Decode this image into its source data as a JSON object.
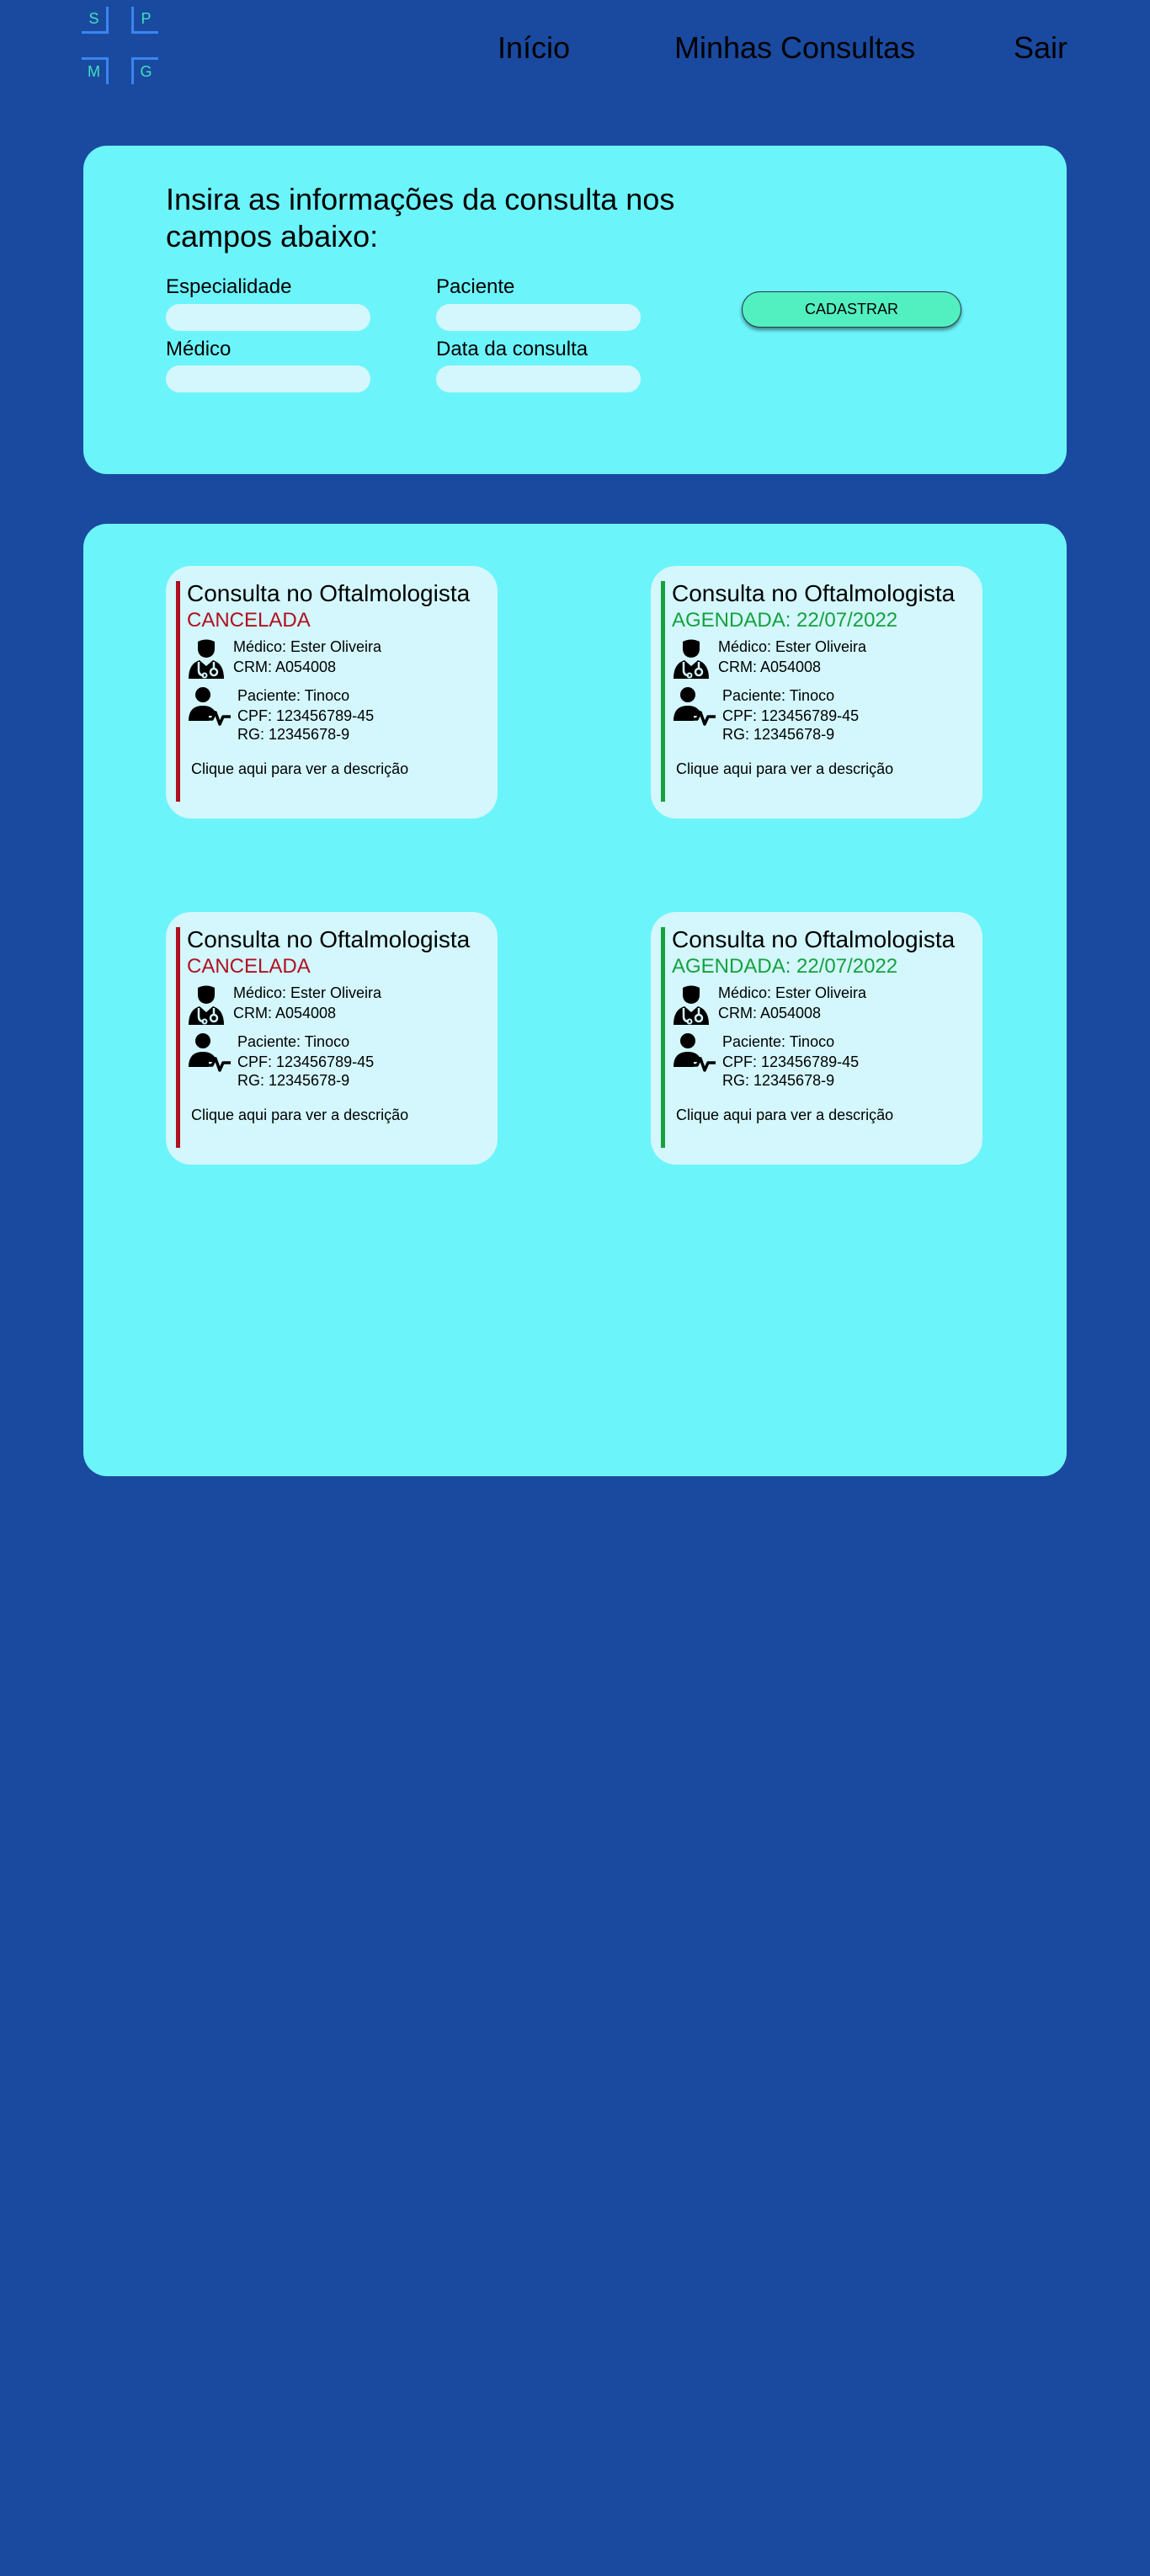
{
  "logo": {
    "letters": [
      "S",
      "P",
      "M",
      "G"
    ]
  },
  "nav": {
    "inicio": "Início",
    "consultas": "Minhas Consultas",
    "sair": "Sair"
  },
  "form": {
    "title": "Insira as informações da consulta nos campos abaixo:",
    "especialidade_label": "Especialidade",
    "paciente_label": "Paciente",
    "medico_label": "Médico",
    "data_label": "Data da consulta",
    "especialidade_value": "",
    "paciente_value": "",
    "medico_value": "",
    "data_value": "",
    "submit_label": "CADASTRAR"
  },
  "colors": {
    "background": "#1a4aa0",
    "panel": "#6cf4fb",
    "card": "#d3f7fd",
    "cancelled": "#b01020",
    "scheduled": "#16a040",
    "button": "#52f0c0"
  },
  "cards": [
    {
      "title": "Consulta no Oftalmologista",
      "status": "CANCELADA",
      "status_type": "cancelled",
      "medico": "Médico: Ester Oliveira",
      "crm": "CRM: A054008",
      "paciente": "Paciente: Tinoco",
      "cpf": "CPF: 123456789-45",
      "rg": "RG: 12345678-9",
      "description_link": "Clique aqui para ver a descrição",
      "doctor_icon": "doctor-icon",
      "patient_icon": "patient-icon"
    },
    {
      "title": "Consulta no Oftalmologista",
      "status": "AGENDADA: 22/07/2022",
      "status_type": "scheduled",
      "medico": "Médico: Ester Oliveira",
      "crm": "CRM: A054008",
      "paciente": "Paciente: Tinoco",
      "cpf": "CPF: 123456789-45",
      "rg": "RG: 12345678-9",
      "description_link": "Clique aqui para ver a descrição",
      "doctor_icon": "doctor-icon",
      "patient_icon": "patient-icon"
    },
    {
      "title": "Consulta no Oftalmologista",
      "status": "CANCELADA",
      "status_type": "cancelled",
      "medico": "Médico: Ester Oliveira",
      "crm": "CRM: A054008",
      "paciente": "Paciente: Tinoco",
      "cpf": "CPF: 123456789-45",
      "rg": "RG: 12345678-9",
      "description_link": "Clique aqui para ver a descrição",
      "doctor_icon": "doctor-icon",
      "patient_icon": "patient-icon"
    },
    {
      "title": "Consulta no Oftalmologista",
      "status": "AGENDADA: 22/07/2022",
      "status_type": "scheduled",
      "medico": "Médico: Ester Oliveira",
      "crm": "CRM: A054008",
      "paciente": "Paciente: Tinoco",
      "cpf": "CPF: 123456789-45",
      "rg": "RG: 12345678-9",
      "description_link": "Clique aqui para ver a descrição",
      "doctor_icon": "doctor-icon",
      "patient_icon": "patient-icon"
    }
  ]
}
